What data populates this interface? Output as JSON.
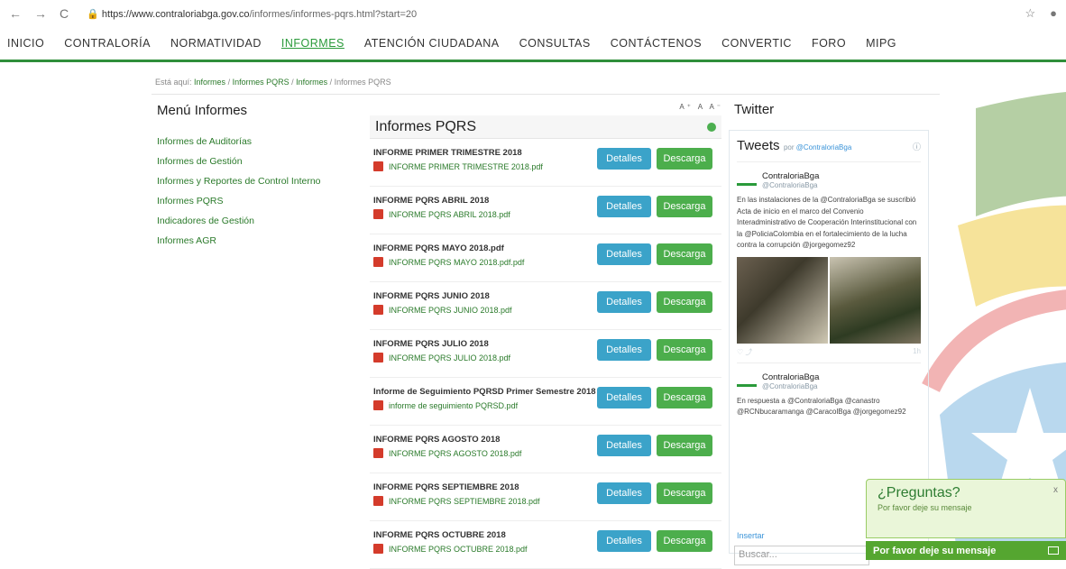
{
  "browser": {
    "url_domain": "https://www.contraloriabga.gov.co",
    "url_path": "/informes/informes-pqrs.html?start=20"
  },
  "nav": [
    "INICIO",
    "CONTRALORÍA",
    "NORMATIVIDAD",
    "INFORMES",
    "ATENCIÓN CIUDADANA",
    "CONSULTAS",
    "CONTÁCTENOS",
    "CONVERTIC",
    "FORO",
    "MIPG"
  ],
  "breadcrumb": {
    "prefix": "Está aquí:",
    "items": [
      "Informes",
      "Informes PQRS",
      "Informes",
      "Informes PQRS"
    ]
  },
  "sidebar": {
    "title": "Menú Informes",
    "items": [
      "Informes de Auditorías",
      "Informes de Gestión",
      "Informes y Reportes de Control Interno",
      "Informes PQRS",
      "Indicadores de Gestión",
      "Informes AGR"
    ]
  },
  "main": {
    "title": "Informes PQRS",
    "text_size": "A⁺ A A⁻",
    "details_label": "Detalles",
    "download_label": "Descarga",
    "rows": [
      {
        "title": "INFORME PRIMER TRIMESTRE 2018",
        "file": "INFORME PRIMER TRIMESTRE 2018.pdf"
      },
      {
        "title": "INFORME PQRS ABRIL 2018",
        "file": "INFORME PQRS ABRIL 2018.pdf"
      },
      {
        "title": "INFORME PQRS MAYO 2018.pdf",
        "file": "INFORME PQRS MAYO 2018.pdf.pdf"
      },
      {
        "title": "INFORME PQRS JUNIO 2018",
        "file": "INFORME PQRS JUNIO 2018.pdf"
      },
      {
        "title": "INFORME PQRS JULIO 2018",
        "file": "INFORME PQRS JULIO 2018.pdf"
      },
      {
        "title": "Informe de Seguimiento PQRSD Primer Semestre 2018",
        "file": "informe de seguimiento PQRSD.pdf"
      },
      {
        "title": "INFORME PQRS AGOSTO 2018",
        "file": "INFORME PQRS AGOSTO 2018.pdf"
      },
      {
        "title": "INFORME PQRS SEPTIEMBRE 2018",
        "file": "INFORME PQRS SEPTIEMBRE 2018.pdf"
      },
      {
        "title": "INFORME PQRS OCTUBRE 2018",
        "file": "INFORME PQRS OCTUBRE 2018.pdf"
      }
    ]
  },
  "twitter": {
    "heading": "Twitter",
    "box_title": "Tweets",
    "by": "por",
    "by_handle": "@ContraloriaBga",
    "tweets": [
      {
        "name": "ContraloriaBga",
        "handle": "@ContraloriaBga",
        "text": "En las instalaciones de la @ContraloriaBga se suscribió Acta de inicio en el marco del Convenio Interadministrativo de Cooperación Interinstitucional con la @PoliciaColombia en el fortalecimiento de la lucha contra la corrupción @jorgegomez92",
        "count": "1h"
      },
      {
        "name": "ContraloriaBga",
        "handle": "@ContraloriaBga",
        "text": "En respuesta a @ContraloriaBga @canastro @RCNbucaramanga @CaracolBga @jorgegomez92"
      }
    ],
    "insert_label": "Insertar",
    "search_placeholder": "Buscar..."
  },
  "chat": {
    "question": "¿Preguntas?",
    "subtitle": "Por favor deje su mensaje",
    "close": "x",
    "bar_label": "Por favor deje su mensaje"
  }
}
